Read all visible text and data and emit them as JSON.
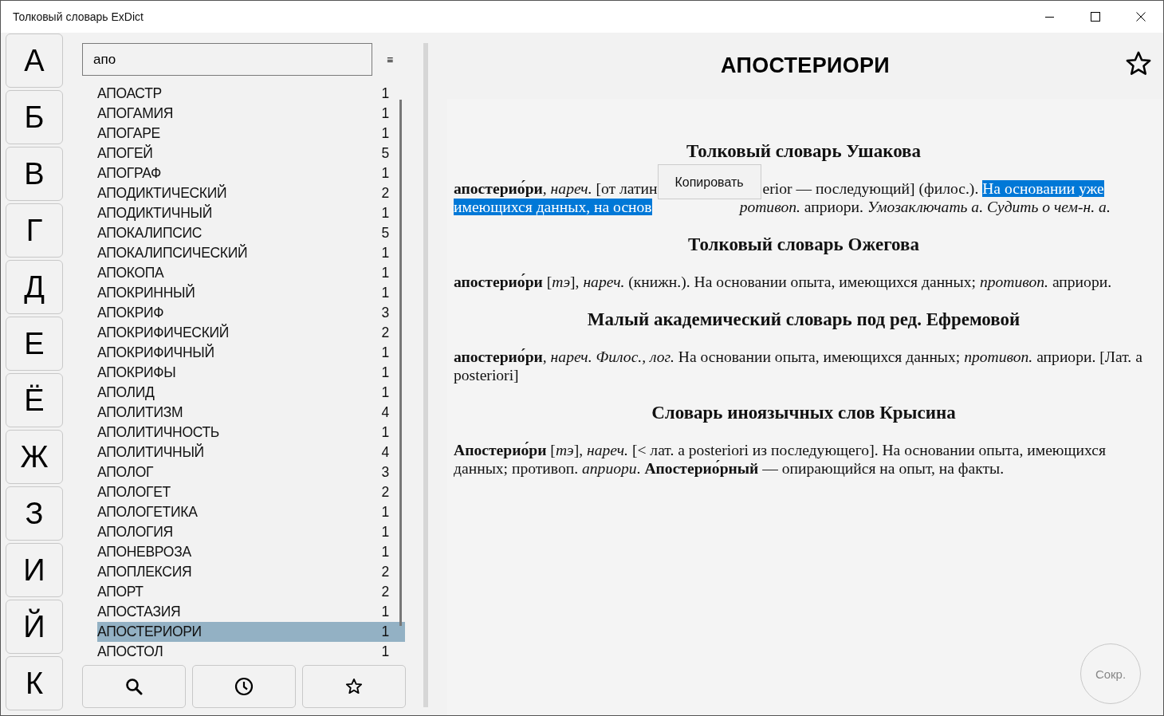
{
  "window": {
    "title": "Толковый словарь ExDict"
  },
  "letters": [
    "А",
    "Б",
    "В",
    "Г",
    "Д",
    "Е",
    "Ё",
    "Ж",
    "З",
    "И",
    "Й",
    "К"
  ],
  "search": {
    "value": "апо",
    "menu_glyph": "≡"
  },
  "words": [
    {
      "word": "АПОАСТР",
      "count": "1",
      "selected": false
    },
    {
      "word": "АПОГАМИЯ",
      "count": "1",
      "selected": false
    },
    {
      "word": "АПОГАРЕ",
      "count": "1",
      "selected": false
    },
    {
      "word": "АПОГЕЙ",
      "count": "5",
      "selected": false
    },
    {
      "word": "АПОГРАФ",
      "count": "1",
      "selected": false
    },
    {
      "word": "АПОДИКТИЧЕСКИЙ",
      "count": "2",
      "selected": false
    },
    {
      "word": "АПОДИКТИЧНЫЙ",
      "count": "1",
      "selected": false
    },
    {
      "word": "АПОКАЛИПСИС",
      "count": "5",
      "selected": false
    },
    {
      "word": "АПОКАЛИПСИЧЕСКИЙ",
      "count": "1",
      "selected": false
    },
    {
      "word": "АПОКОПА",
      "count": "1",
      "selected": false
    },
    {
      "word": "АПОКРИННЫЙ",
      "count": "1",
      "selected": false
    },
    {
      "word": "АПОКРИФ",
      "count": "3",
      "selected": false
    },
    {
      "word": "АПОКРИФИЧЕСКИЙ",
      "count": "2",
      "selected": false
    },
    {
      "word": "АПОКРИФИЧНЫЙ",
      "count": "1",
      "selected": false
    },
    {
      "word": "АПОКРИФЫ",
      "count": "1",
      "selected": false
    },
    {
      "word": "АПОЛИД",
      "count": "1",
      "selected": false
    },
    {
      "word": "АПОЛИТИЗМ",
      "count": "4",
      "selected": false
    },
    {
      "word": "АПОЛИТИЧНОСТЬ",
      "count": "1",
      "selected": false
    },
    {
      "word": "АПОЛИТИЧНЫЙ",
      "count": "4",
      "selected": false
    },
    {
      "word": "АПОЛОГ",
      "count": "3",
      "selected": false
    },
    {
      "word": "АПОЛОГЕТ",
      "count": "2",
      "selected": false
    },
    {
      "word": "АПОЛОГЕТИКА",
      "count": "1",
      "selected": false
    },
    {
      "word": "АПОЛОГИЯ",
      "count": "1",
      "selected": false
    },
    {
      "word": "АПОНЕВРОЗА",
      "count": "1",
      "selected": false
    },
    {
      "word": "АПОПЛЕКСИЯ",
      "count": "2",
      "selected": false
    },
    {
      "word": "АПОРТ",
      "count": "2",
      "selected": false
    },
    {
      "word": "АПОСТАЗИЯ",
      "count": "1",
      "selected": false
    },
    {
      "word": "АПОСТЕРИОРИ",
      "count": "1",
      "selected": true
    },
    {
      "word": "АПОСТОЛ",
      "count": "1",
      "selected": false
    }
  ],
  "bottom_tabs": [
    {
      "kind": "search"
    },
    {
      "kind": "history"
    },
    {
      "kind": "favorites"
    }
  ],
  "article": {
    "title": "АПОСТЕРИОРИ",
    "favorite": false,
    "sections": [
      {
        "kind": "lines",
        "heading": "Толковый словарь Ушакова",
        "lines": [
          [
            {
              "kind": "text",
              "text": "**апостерио́ри**, *нареч.* [от латин",
              "selected": false
            },
            {
              "kind": "covered"
            },
            {
              "kind": "text",
              "text": "erior — последующий] (филос.). ",
              "selected": false
            },
            {
              "kind": "text",
              "text": "На основании уже",
              "selected": true
            }
          ],
          [
            {
              "kind": "text",
              "text": "имеющихся данных, на основ",
              "selected": true
            },
            {
              "kind": "covered"
            },
            {
              "kind": "text",
              "text": "*ротивоп.* априори. *Умозаключать а. Судить о чем-н. а.*",
              "selected": false
            }
          ]
        ]
      },
      {
        "kind": "paragraph",
        "heading": "Толковый словарь Ожегова",
        "text": "**апостерио́ри** [*тэ*], *нареч.* (книжн.). На основании опыта, имеющихся данных; *противоп.* априори."
      },
      {
        "kind": "paragraph",
        "heading": "Малый академический словарь под ред. Ефремовой",
        "text": "**апостерио́ри**, *нареч. Филос., лог.* На основании опыта, имеющихся данных; *противоп.* априори. [Лат. a posteriori]"
      },
      {
        "kind": "paragraph",
        "heading": "Словарь иноязычных слов Крысина",
        "text": "**Апостерио́ри** [*тэ*], *нареч.* [< лат. a posteriori из последующего]. На основании опыта, имеющихся данных; противоп. *априори*. **Апостерио́рный** — опирающийся на опыт, на факты."
      }
    ]
  },
  "context_menu": {
    "items": [
      "Копировать"
    ]
  },
  "fab": {
    "label": "Сокр."
  }
}
